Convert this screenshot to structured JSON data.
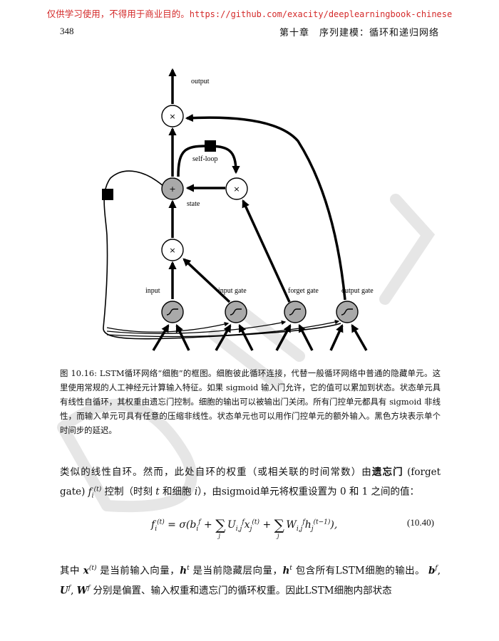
{
  "banner": {
    "prefix": "仅供学习使用，不得用于商业目的。",
    "url": "https://github.com/exacity/deeplearningbook-chinese"
  },
  "header": {
    "page_number": "348",
    "running_head": "第十章　序列建模：循环和递归网络"
  },
  "figure": {
    "labels": {
      "output": "output",
      "self_loop": "self-loop",
      "state": "state",
      "input": "input",
      "input_gate": "input gate",
      "forget_gate": "forget gate",
      "output_gate": "output gate"
    },
    "symbols": {
      "multiply": "×",
      "add": "+",
      "sigmoid": "∫"
    }
  },
  "caption": {
    "text": "图 10.16: LSTM循环网络“细胞”的框图。细胞彼此循环连接，代替一般循环网络中普通的隐藏单元。这里使用常规的人工神经元计算输入特征。如果 sigmoid 输入门允许，它的值可以累加到状态。状态单元具有线性自循环，其权重由遗忘门控制。细胞的输出可以被输出门关闭。所有门控单元都具有 sigmoid 非线性，而输入单元可具有任意的压缩非线性。状态单元也可以用作门控单元的额外输入。黑色方块表示单个时间步的延迟。"
  },
  "body": {
    "p1_a": "类似的线性自环。然而，此处自环的权重（或相关联的时间常数）由",
    "p1_term": "遗忘门",
    "p1_b": "(forget gate)",
    "p1_c": "控制（时刻",
    "p1_d": "和细胞",
    "p1_e": "），由sigmoid单元将权重设置为 0 和 1 之间的值：",
    "eq_number": "(10.40)",
    "p2_a": "其中",
    "p2_b": "是当前输入向量，",
    "p2_c": "是当前隐藏层向量，",
    "p2_d": "包含所有LSTM细胞的输出。",
    "p2_e": "分别是偏置、输入权重和遗忘门的循环权重。因此LSTM细胞内部状态"
  },
  "watermark": {
    "text": "DRAFT"
  }
}
